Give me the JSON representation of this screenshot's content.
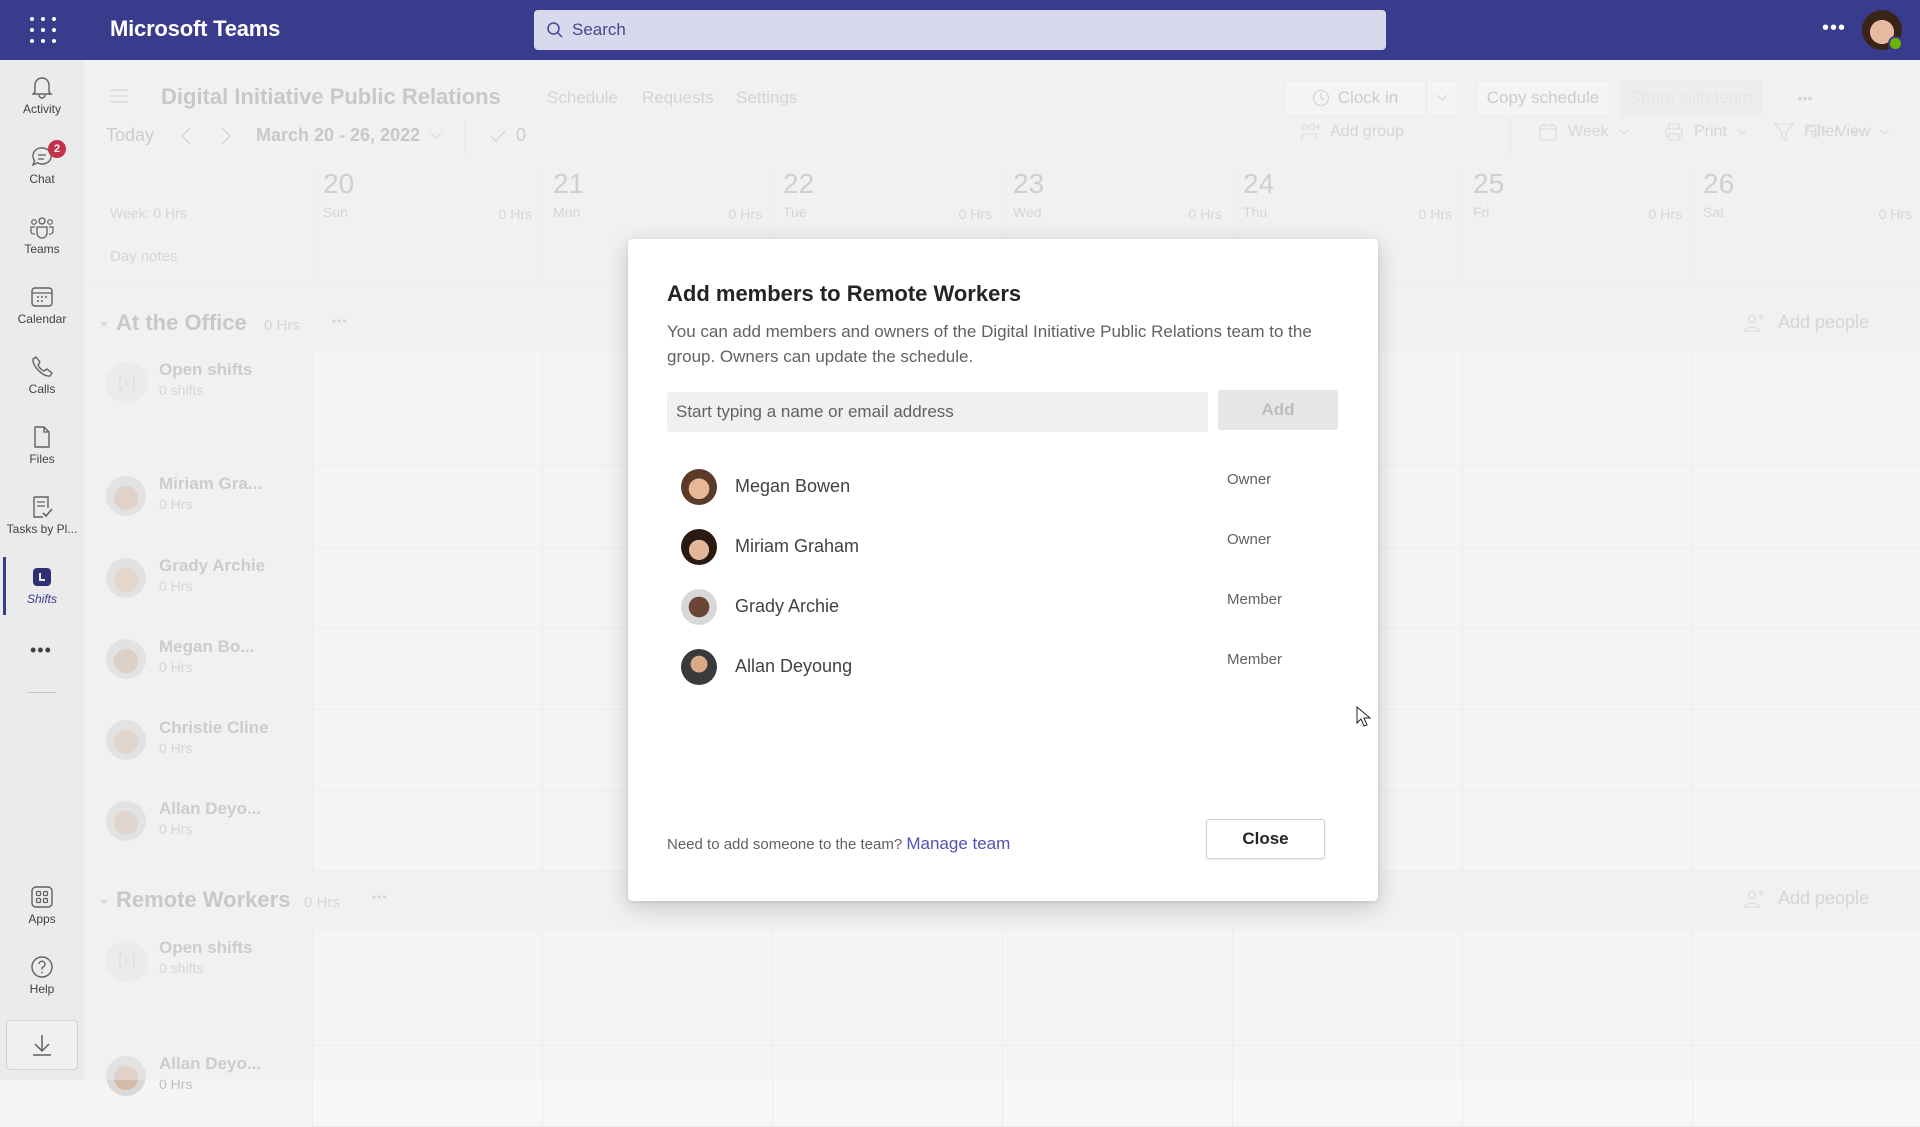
{
  "topbar": {
    "app_title": "Microsoft Teams",
    "search_placeholder": "Search",
    "more_label": "•••",
    "colors": {
      "brand": "#393b8c",
      "presence": "#6bb700"
    }
  },
  "rail": {
    "items": [
      {
        "label": "Activity",
        "icon": "bell-icon"
      },
      {
        "label": "Chat",
        "icon": "chat-icon",
        "badge": "2"
      },
      {
        "label": "Teams",
        "icon": "teams-icon"
      },
      {
        "label": "Calendar",
        "icon": "calendar-icon"
      },
      {
        "label": "Calls",
        "icon": "phone-icon"
      },
      {
        "label": "Files",
        "icon": "file-icon"
      },
      {
        "label": "Tasks by Pl...",
        "icon": "tasks-icon"
      },
      {
        "label": "Shifts",
        "icon": "shifts-icon",
        "active": true
      }
    ],
    "more_label": "•••",
    "bottom_items": [
      {
        "label": "Apps",
        "icon": "apps-icon"
      },
      {
        "label": "Help",
        "icon": "help-icon"
      }
    ]
  },
  "schedule": {
    "team_title": "Digital Initiative Public Relations",
    "tabs": [
      "Schedule",
      "Requests",
      "Settings"
    ],
    "actions": {
      "clock_in": "Clock in",
      "copy_schedule": "Copy schedule",
      "share_with_team": "Share with team",
      "more": "•••"
    },
    "toolbar": {
      "today": "Today",
      "date_range": "March 20 - 26, 2022",
      "approved_count": "0",
      "add_group": "Add group",
      "week": "Week",
      "print": "Print",
      "filter": "Filter",
      "view": "View"
    },
    "week_hours": "Week: 0 Hrs",
    "day_notes": "Day notes",
    "days": [
      {
        "num": "20",
        "name": "Sun",
        "hrs": "0 Hrs"
      },
      {
        "num": "21",
        "name": "Mon",
        "hrs": "0 Hrs"
      },
      {
        "num": "22",
        "name": "Tue",
        "hrs": "0 Hrs"
      },
      {
        "num": "23",
        "name": "Wed",
        "hrs": "0 Hrs"
      },
      {
        "num": "24",
        "name": "Thu",
        "hrs": "0 Hrs"
      },
      {
        "num": "25",
        "name": "Fri",
        "hrs": "0 Hrs"
      },
      {
        "num": "26",
        "name": "Sat",
        "hrs": "0 Hrs"
      }
    ],
    "groups": [
      {
        "name": "At the Office",
        "hrs": "0 Hrs",
        "add_people": "Add people",
        "rows": [
          {
            "name": "Open shifts",
            "sub": "0 shifts",
            "open": true
          },
          {
            "name": "Miriam Gra...",
            "sub": "0 Hrs"
          },
          {
            "name": "Grady Archie",
            "sub": "0 Hrs"
          },
          {
            "name": "Megan Bo...",
            "sub": "0 Hrs"
          },
          {
            "name": "Christie Cline",
            "sub": "0 Hrs"
          },
          {
            "name": "Allan Deyo...",
            "sub": "0 Hrs"
          }
        ]
      },
      {
        "name": "Remote Workers",
        "hrs": "0 Hrs",
        "add_people": "Add people",
        "rows": [
          {
            "name": "Open shifts",
            "sub": "0 shifts",
            "open": true
          },
          {
            "name": "Allan Deyo...",
            "sub": "0 Hrs"
          }
        ]
      }
    ]
  },
  "modal": {
    "title": "Add members to Remote Workers",
    "description": "You can add members and owners of the Digital Initiative Public Relations team to the group. Owners can update the schedule.",
    "input_placeholder": "Start typing a name or email address",
    "input_value": "",
    "add_label": "Add",
    "members": [
      {
        "name": "Megan Bowen",
        "role": "Owner"
      },
      {
        "name": "Miriam Graham",
        "role": "Owner"
      },
      {
        "name": "Grady Archie",
        "role": "Member"
      },
      {
        "name": "Allan Deyoung",
        "role": "Member"
      }
    ],
    "footer_text": "Need to add someone to the team?",
    "manage_link": "Manage team",
    "close_label": "Close",
    "colors": {
      "link": "#4f52b2"
    }
  }
}
